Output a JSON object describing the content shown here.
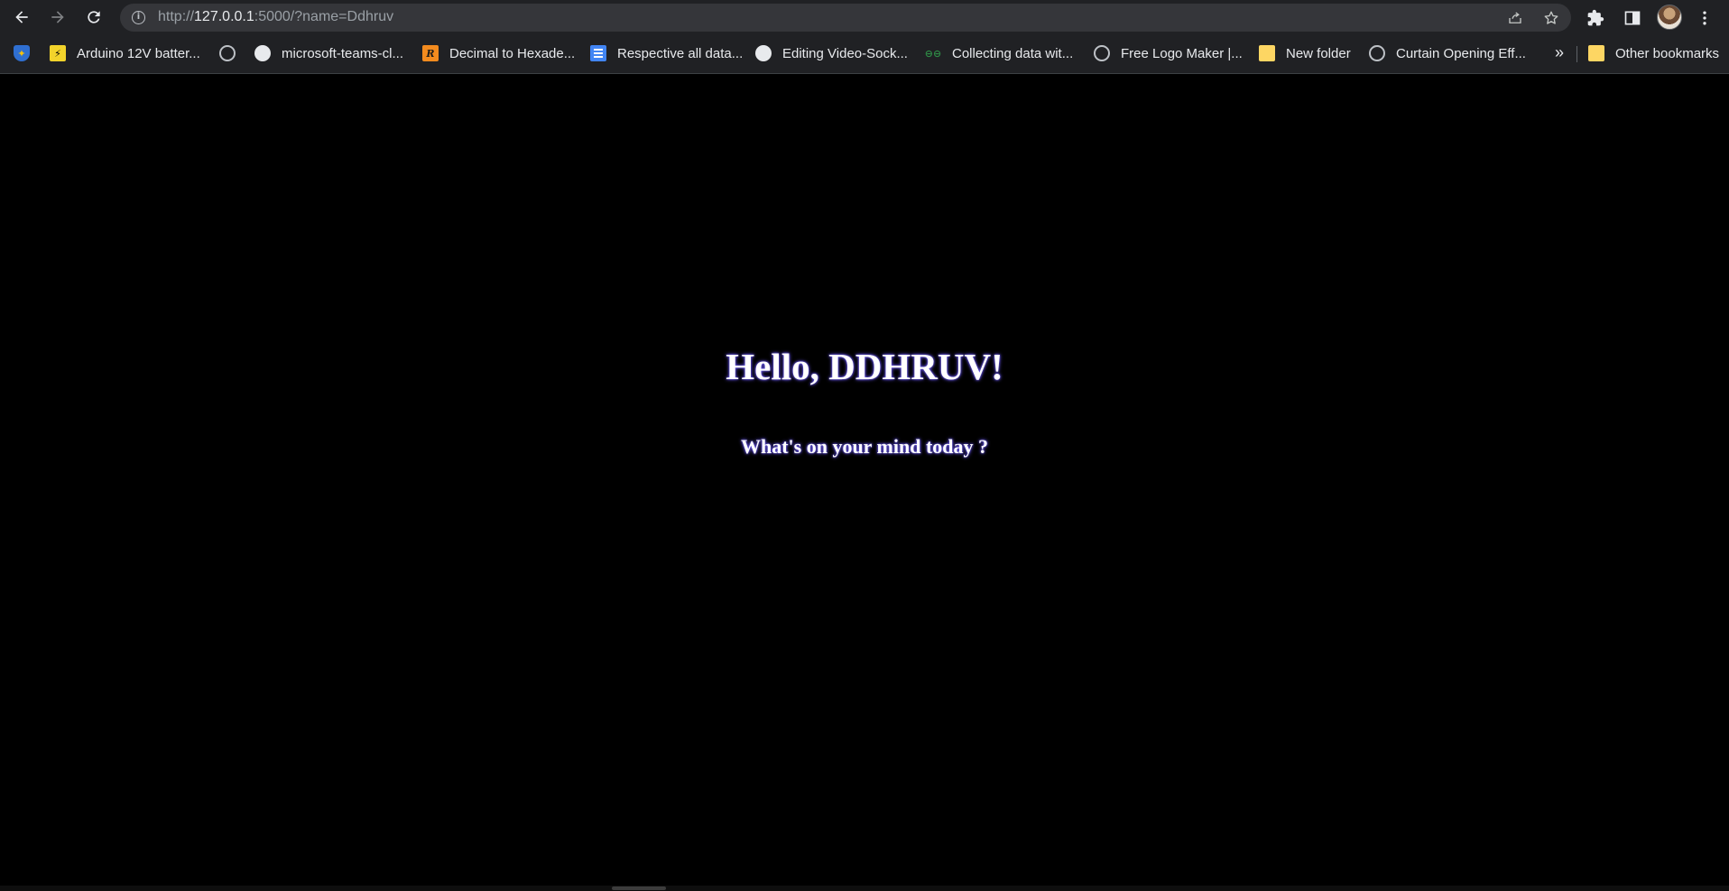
{
  "browser": {
    "url_scheme": "http://",
    "url_host": "127.0.0.1",
    "url_rest": ":5000/?name=Ddhruv",
    "icons": {
      "back": "arrow-left-icon",
      "forward": "arrow-right-icon",
      "reload": "reload-icon",
      "info": "info-icon",
      "share": "share-icon",
      "star": "star-icon",
      "extensions": "puzzle-icon",
      "side_panel": "side-panel-icon",
      "menu": "vertical-dots-icon"
    },
    "colors": {
      "toolbar_bg": "#202124",
      "omnibox_bg": "#35363a",
      "page_bg": "#000000",
      "text_glow": "#6f5cff"
    }
  },
  "bookmarks": {
    "items": [
      {
        "label": "",
        "icon": "shield-icon"
      },
      {
        "label": "Arduino 12V batter...",
        "icon": "arduino-icon"
      },
      {
        "label": "",
        "icon": "globe-icon"
      },
      {
        "label": "microsoft-teams-cl...",
        "icon": "github-icon"
      },
      {
        "label": "Decimal to Hexade...",
        "icon": "r-logo-icon"
      },
      {
        "label": "Respective all data...",
        "icon": "docs-icon"
      },
      {
        "label": "Editing Video-Sock...",
        "icon": "github-icon"
      },
      {
        "label": "Collecting data wit...",
        "icon": "gfg-icon"
      },
      {
        "label": "Free Logo Maker |...",
        "icon": "globe-icon"
      },
      {
        "label": "New folder",
        "icon": "folder-icon"
      },
      {
        "label": "Curtain Opening Eff...",
        "icon": "globe-icon"
      }
    ],
    "overflow_label": "»",
    "other_label": "Other bookmarks"
  },
  "page": {
    "greeting": "Hello, DDHRUV!",
    "prompt": "What's on your mind today ?"
  }
}
